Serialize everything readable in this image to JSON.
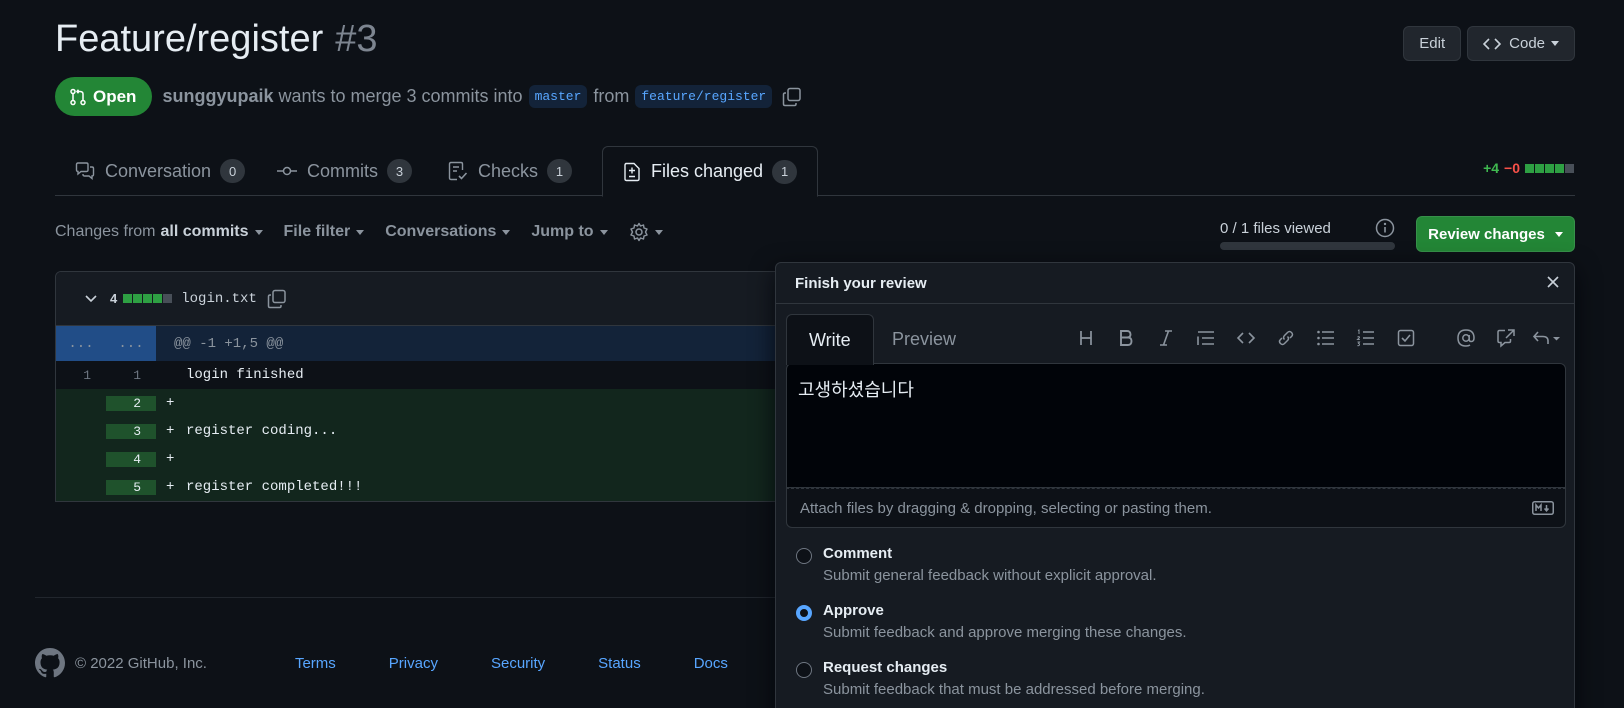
{
  "pr": {
    "title": "Feature/register",
    "number": "#3",
    "state": "Open",
    "author": "sunggyupaik",
    "merge_text": "wants to merge 3 commits into",
    "base_branch": "master",
    "from_text": "from",
    "head_branch": "feature/register"
  },
  "header_actions": {
    "edit": "Edit",
    "code": "Code"
  },
  "tabs": [
    {
      "label": "Conversation",
      "count": "0"
    },
    {
      "label": "Commits",
      "count": "3"
    },
    {
      "label": "Checks",
      "count": "1"
    },
    {
      "label": "Files changed",
      "count": "1"
    }
  ],
  "diffstat": {
    "additions": "+4",
    "deletions": "−0"
  },
  "toolbar": {
    "changes_from_prefix": "Changes from",
    "changes_from_value": "all commits",
    "file_filter": "File filter",
    "conversations": "Conversations",
    "jump_to": "Jump to",
    "files_viewed": "0 / 1 files viewed",
    "review_changes": "Review changes"
  },
  "file": {
    "changes_count": "4",
    "name": "login.txt",
    "hunk_left": "...",
    "hunk_right": "...",
    "hunk_header": "@@ -1 +1,5 @@",
    "lines": [
      {
        "old": "1",
        "new": "1",
        "sign": " ",
        "code": "login finished"
      },
      {
        "old": "",
        "new": "2",
        "sign": "+",
        "code": ""
      },
      {
        "old": "",
        "new": "3",
        "sign": "+",
        "code": "register coding..."
      },
      {
        "old": "",
        "new": "4",
        "sign": "+",
        "code": ""
      },
      {
        "old": "",
        "new": "5",
        "sign": "+",
        "code": "register completed!!!"
      }
    ]
  },
  "review": {
    "heading": "Finish your review",
    "write_tab": "Write",
    "preview_tab": "Preview",
    "body_text": "고생하셨습니다",
    "attach_hint": "Attach files by dragging & dropping, selecting or pasting them.",
    "options": [
      {
        "title": "Comment",
        "desc": "Submit general feedback without explicit approval.",
        "checked": false
      },
      {
        "title": "Approve",
        "desc": "Submit feedback and approve merging these changes.",
        "checked": true
      },
      {
        "title": "Request changes",
        "desc": "Submit feedback that must be addressed before merging.",
        "checked": false
      }
    ]
  },
  "footer": {
    "copyright": "© 2022 GitHub, Inc.",
    "links": [
      "Terms",
      "Privacy",
      "Security",
      "Status",
      "Docs"
    ]
  },
  "colors": {
    "background": "#0d1117",
    "open_badge": "#238636",
    "link": "#58a6ff",
    "addition": "#3fb950",
    "deletion": "#f85149"
  }
}
